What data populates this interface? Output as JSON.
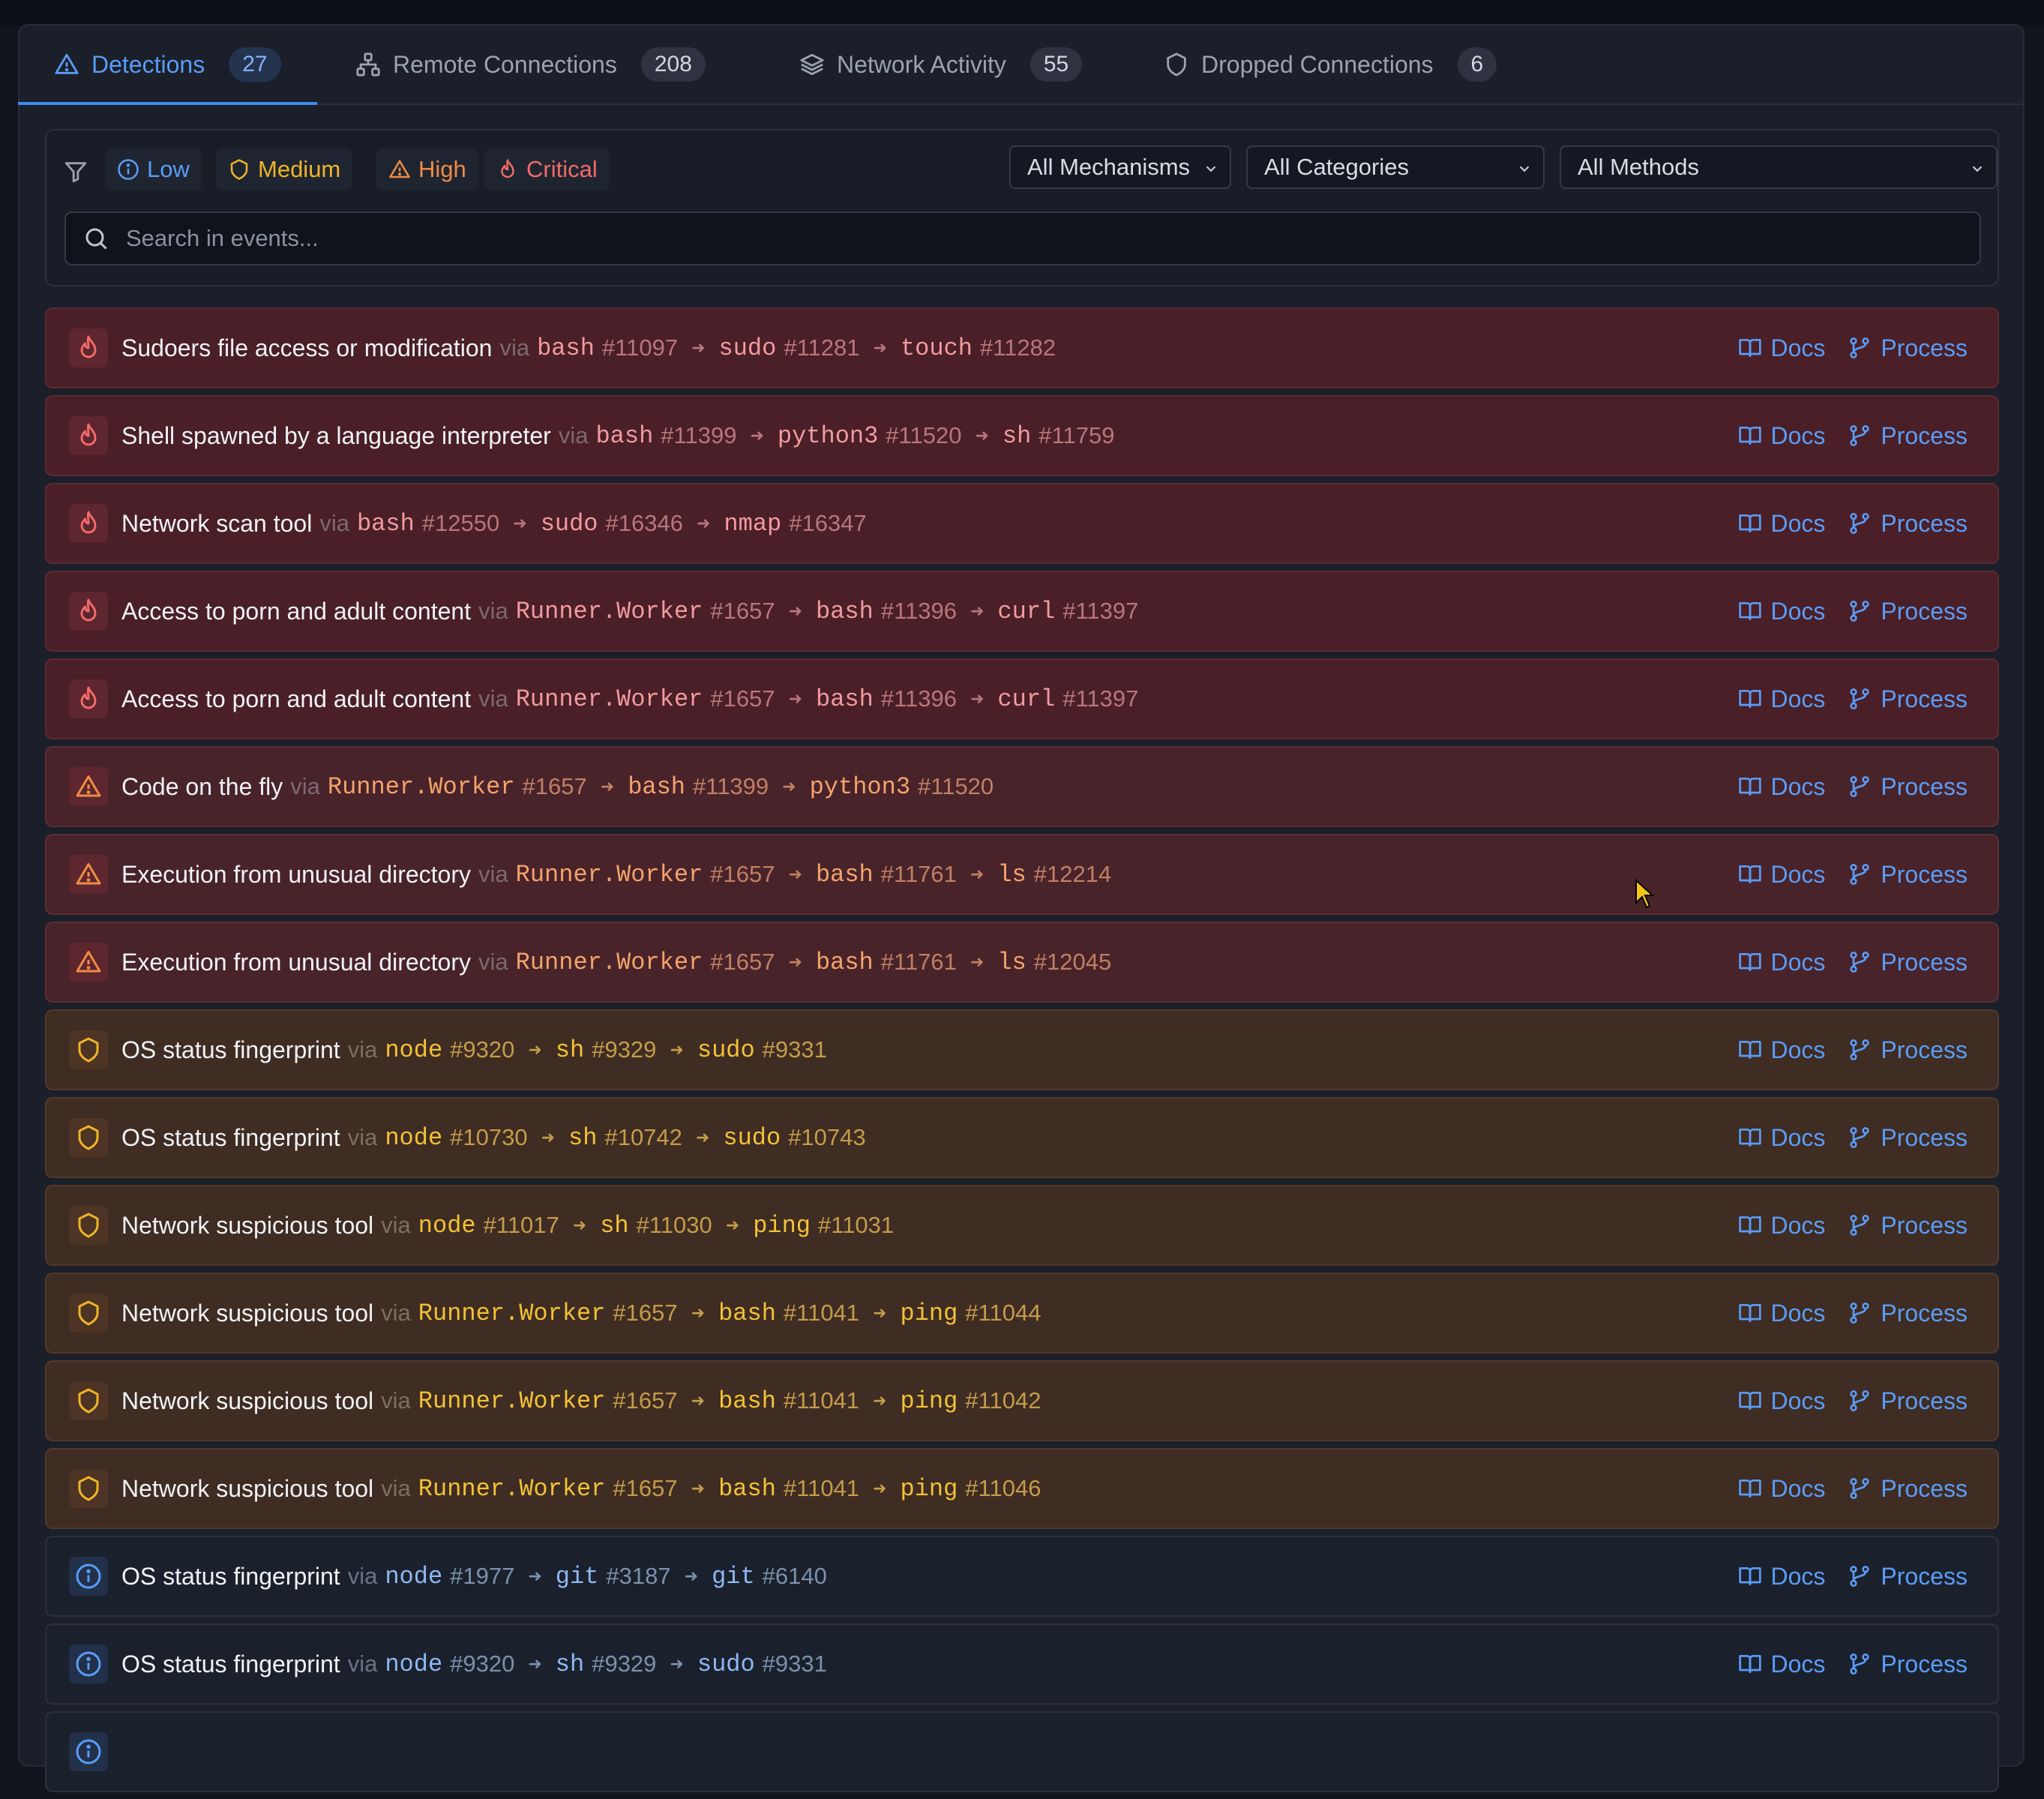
{
  "tabs": [
    {
      "label": "Detections",
      "count": "27",
      "icon": "warning-icon",
      "active": true
    },
    {
      "label": "Remote Connections",
      "count": "208",
      "icon": "network-icon"
    },
    {
      "label": "Network Activity",
      "count": "55",
      "icon": "layers-icon"
    },
    {
      "label": "Dropped Connections",
      "count": "6",
      "icon": "shield-icon"
    }
  ],
  "filters": {
    "severities": {
      "low": "Low",
      "medium": "Medium",
      "high": "High",
      "critical": "Critical"
    },
    "mechanism": "All Mechanisms",
    "category": "All Categories",
    "method": "All Methods"
  },
  "search": {
    "placeholder": "Search in events...",
    "value": ""
  },
  "labels": {
    "via": "via",
    "docs": "Docs",
    "process": "Process",
    "hash": "#"
  },
  "colors": {
    "accent": "#3d8bf2",
    "critical": "#f26a6a",
    "high": "#f08c45",
    "medium": "#f0b429",
    "low": "#5a9cf8"
  },
  "events": [
    {
      "severity": "critical",
      "title": "Sudoers file access or modification",
      "chain": [
        {
          "proc": "bash",
          "pid": "11097"
        },
        {
          "proc": "sudo",
          "pid": "11281"
        },
        {
          "proc": "touch",
          "pid": "11282"
        }
      ]
    },
    {
      "severity": "critical",
      "title": "Shell spawned by a language interpreter",
      "chain": [
        {
          "proc": "bash",
          "pid": "11399"
        },
        {
          "proc": "python3",
          "pid": "11520"
        },
        {
          "proc": "sh",
          "pid": "11759"
        }
      ]
    },
    {
      "severity": "critical",
      "title": "Network scan tool",
      "chain": [
        {
          "proc": "bash",
          "pid": "12550"
        },
        {
          "proc": "sudo",
          "pid": "16346"
        },
        {
          "proc": "nmap",
          "pid": "16347"
        }
      ]
    },
    {
      "severity": "critical",
      "title": "Access to porn and adult content",
      "chain": [
        {
          "proc": "Runner.Worker",
          "pid": "1657"
        },
        {
          "proc": "bash",
          "pid": "11396"
        },
        {
          "proc": "curl",
          "pid": "11397"
        }
      ]
    },
    {
      "severity": "critical",
      "title": "Access to porn and adult content",
      "chain": [
        {
          "proc": "Runner.Worker",
          "pid": "1657"
        },
        {
          "proc": "bash",
          "pid": "11396"
        },
        {
          "proc": "curl",
          "pid": "11397"
        }
      ]
    },
    {
      "severity": "high",
      "title": "Code on the fly",
      "chain": [
        {
          "proc": "Runner.Worker",
          "pid": "1657"
        },
        {
          "proc": "bash",
          "pid": "11399"
        },
        {
          "proc": "python3",
          "pid": "11520"
        }
      ]
    },
    {
      "severity": "high",
      "title": "Execution from unusual directory",
      "chain": [
        {
          "proc": "Runner.Worker",
          "pid": "1657"
        },
        {
          "proc": "bash",
          "pid": "11761"
        },
        {
          "proc": "ls",
          "pid": "12214"
        }
      ]
    },
    {
      "severity": "high",
      "title": "Execution from unusual directory",
      "chain": [
        {
          "proc": "Runner.Worker",
          "pid": "1657"
        },
        {
          "proc": "bash",
          "pid": "11761"
        },
        {
          "proc": "ls",
          "pid": "12045"
        }
      ]
    },
    {
      "severity": "medium",
      "title": "OS status fingerprint",
      "chain": [
        {
          "proc": "node",
          "pid": "9320"
        },
        {
          "proc": "sh",
          "pid": "9329"
        },
        {
          "proc": "sudo",
          "pid": "9331"
        }
      ]
    },
    {
      "severity": "medium",
      "title": "OS status fingerprint",
      "chain": [
        {
          "proc": "node",
          "pid": "10730"
        },
        {
          "proc": "sh",
          "pid": "10742"
        },
        {
          "proc": "sudo",
          "pid": "10743"
        }
      ]
    },
    {
      "severity": "medium",
      "title": "Network suspicious tool",
      "chain": [
        {
          "proc": "node",
          "pid": "11017"
        },
        {
          "proc": "sh",
          "pid": "11030"
        },
        {
          "proc": "ping",
          "pid": "11031"
        }
      ]
    },
    {
      "severity": "medium",
      "title": "Network suspicious tool",
      "chain": [
        {
          "proc": "Runner.Worker",
          "pid": "1657"
        },
        {
          "proc": "bash",
          "pid": "11041"
        },
        {
          "proc": "ping",
          "pid": "11044"
        }
      ]
    },
    {
      "severity": "medium",
      "title": "Network suspicious tool",
      "chain": [
        {
          "proc": "Runner.Worker",
          "pid": "1657"
        },
        {
          "proc": "bash",
          "pid": "11041"
        },
        {
          "proc": "ping",
          "pid": "11042"
        }
      ]
    },
    {
      "severity": "medium",
      "title": "Network suspicious tool",
      "chain": [
        {
          "proc": "Runner.Worker",
          "pid": "1657"
        },
        {
          "proc": "bash",
          "pid": "11041"
        },
        {
          "proc": "ping",
          "pid": "11046"
        }
      ]
    },
    {
      "severity": "low",
      "title": "OS status fingerprint",
      "chain": [
        {
          "proc": "node",
          "pid": "1977"
        },
        {
          "proc": "git",
          "pid": "3187"
        },
        {
          "proc": "git",
          "pid": "6140"
        }
      ]
    },
    {
      "severity": "low",
      "title": "OS status fingerprint",
      "chain": [
        {
          "proc": "node",
          "pid": "9320"
        },
        {
          "proc": "sh",
          "pid": "9329"
        },
        {
          "proc": "sudo",
          "pid": "9331"
        }
      ]
    },
    {
      "severity": "low",
      "title": "",
      "chain": []
    }
  ]
}
